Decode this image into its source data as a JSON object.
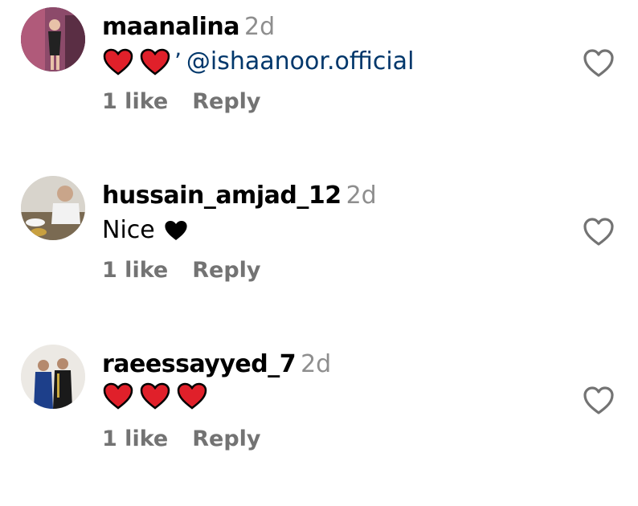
{
  "comments": [
    {
      "username": "maanalina",
      "time": "2d",
      "mention": "@ishaanoor.official",
      "likes": "1 like",
      "reply": "Reply",
      "emojis": [
        "red-heart",
        "red-heart"
      ]
    },
    {
      "username": "hussain_amjad_12",
      "time": "2d",
      "text": "Nice",
      "likes": "1 like",
      "reply": "Reply",
      "emojis": [
        "black-heart"
      ]
    },
    {
      "username": "raeessayyed_7",
      "time": "2d",
      "likes": "1 like",
      "reply": "Reply",
      "emojis": [
        "red-heart",
        "red-heart",
        "red-heart"
      ]
    }
  ],
  "colors": {
    "mention": "#00376b",
    "muted": "#8e8e8e",
    "heart_red": "#e0202a"
  }
}
